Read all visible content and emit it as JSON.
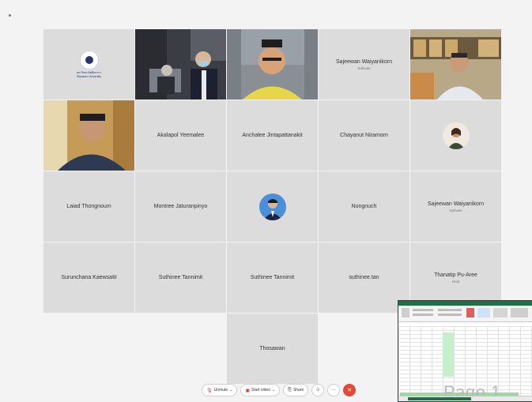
{
  "participants": {
    "row1": {
      "logo_text_line1": "มหาวิทยาลัยศิลปากร",
      "logo_text_line2": "Silpakorn University",
      "tile4_name": "Sajeewan Waiyanikorn",
      "tile4_sub": "Sahwan"
    },
    "row2": {
      "tile2_name": "Akalapol Yeemalee",
      "tile3_name": "Anchalee Jintapattanakit",
      "tile4_name": "Chayanut Niramorn"
    },
    "row3": {
      "tile1_name": "Laiad Thongnoum",
      "tile2_name": "Montree Jaturanpinyo",
      "tile4_name": "Nongnuch",
      "tile5_name": "Sajeewan Waiyanikorn",
      "tile5_sub": "Sahwan"
    },
    "row4": {
      "tile1_name": "Surunchana Kaewsatit",
      "tile2_name": "Suthinee Tannimit",
      "tile3_name": "Suthinee Tannimit",
      "tile4_name": "suthinee.tan",
      "tile5_name": "Thanatip Pu-Aree",
      "tile5_sub": "Host"
    },
    "row5": {
      "tile3_name": "Thosawan"
    }
  },
  "toolbar": {
    "unmute_label": "Unmute",
    "start_video_label": "Start video",
    "share_label": "Share",
    "more_label": "···",
    "leave_label": "✕"
  },
  "shared_screen": {
    "watermark": "Page 1"
  },
  "colors": {
    "tile_bg": "#dcdcdc",
    "leave_red": "#e04a3a",
    "excel_green": "#1f7145"
  },
  "icons": [
    "microphone-muted-icon",
    "video-off-icon",
    "share-screen-icon",
    "reactions-icon",
    "leave-icon",
    "chevron-down-icon"
  ]
}
